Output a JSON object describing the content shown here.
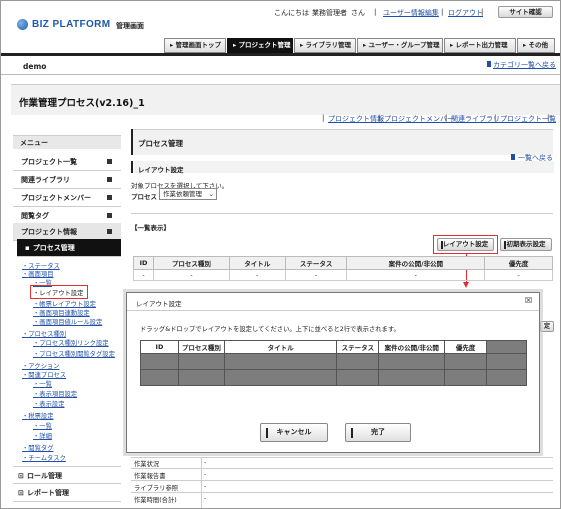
{
  "header": {
    "logo": "BIZ PLATFORM",
    "app_name": "管理画面",
    "greeting": "こんにちは",
    "user_name": "業務管理者",
    "honorific": "さん",
    "sep1": "|",
    "edit_user": "ユーザー情報編集",
    "sep2": "|",
    "logout": "ログアウト",
    "sep3": "|",
    "site_confirm": "サイト確認"
  },
  "nav": {
    "tabs": [
      {
        "label": "管理画面トップ"
      },
      {
        "label": "プロジェクト管理"
      },
      {
        "label": "ライブラリ管理"
      },
      {
        "label": "ユーザー・グループ管理"
      },
      {
        "label": "レポート出力管理"
      },
      {
        "label": "その他"
      }
    ]
  },
  "subnav": {
    "project": "demo",
    "category_back": "カテゴリ一覧へ戻る"
  },
  "page": {
    "title": "作業管理プロセス(v2.16)_1",
    "links": [
      "プロジェクト情報",
      "プロジェクトメンバー",
      "関連ライブラリ",
      "プロジェクト一覧"
    ],
    "link_sep": "|"
  },
  "sidebar": {
    "menu": "メニュー",
    "items": [
      {
        "label": "プロジェクト一覧"
      },
      {
        "label": "関連ライブラリ"
      },
      {
        "label": "プロジェクトメンバー"
      },
      {
        "label": "閲覧タグ"
      },
      {
        "label": "プロジェクト情報"
      },
      {
        "label": "プロセス管理"
      }
    ],
    "tree": [
      {
        "label": "ステータス"
      },
      {
        "label": "画面項目"
      },
      {
        "label": "一覧"
      },
      {
        "label": "レイアウト設定"
      },
      {
        "label": "帳票レイアウト設定"
      },
      {
        "label": "画面項目連動設定"
      },
      {
        "label": "画面項目値ルール設定"
      },
      {
        "label": "プロセス種別"
      },
      {
        "label": "プロセス種別リンク設定"
      },
      {
        "label": "プロセス種別閲覧タグ設定"
      },
      {
        "label": "アクション"
      },
      {
        "label": "関連プロセス"
      },
      {
        "label": "一覧"
      },
      {
        "label": "表示項目設定"
      },
      {
        "label": "表示設定"
      },
      {
        "label": "税票設定"
      },
      {
        "label": "一覧"
      },
      {
        "label": "詳細"
      },
      {
        "label": "閲覧タグ"
      },
      {
        "label": "チームタスク"
      }
    ],
    "bottom": [
      {
        "label": "ロール管理"
      },
      {
        "label": "レポート管理"
      }
    ]
  },
  "main": {
    "section_title": "プロセス管理",
    "layout_title": "レイアウト設定",
    "back_link": "一覧へ戻る",
    "target_text": "対象プロセスを選択して下さい。",
    "process_label": "プロセス",
    "process_select": "作業依頼管理",
    "list_label": "【一覧表示】",
    "layout_btn": "レイアウト設定",
    "initial_btn": "初期表示設定",
    "table": {
      "headers": [
        "ID",
        "プロセス種別",
        "タイトル",
        "ステータス",
        "案件の公開/非公開",
        "優先度"
      ],
      "row": [
        "-",
        "-",
        "-",
        "-",
        "-",
        "-"
      ]
    },
    "partial_btn": "定",
    "lower_rows": [
      {
        "label": "作業状況",
        "value": "-"
      },
      {
        "label": "作業報告書",
        "value": "-"
      },
      {
        "label": "ライブラリ参照",
        "value": "-"
      },
      {
        "label": "作業時間(合計)",
        "value": "-"
      }
    ]
  },
  "dialog": {
    "title": "レイアウト設定",
    "close": "☒",
    "instruction": "ドラッグ&ドロップでレイアウトを設定してください。上下に並べると2行で表示されます。",
    "headers": [
      "ID",
      "プロセス種別",
      "タイトル",
      "ステータス",
      "案件の公開/非公開",
      "優先度"
    ],
    "cancel": "キャンセル",
    "done": "完了"
  },
  "colors": {
    "accent_red": "#e03030",
    "link_blue": "#1f4fa8",
    "dark": "#111111"
  }
}
